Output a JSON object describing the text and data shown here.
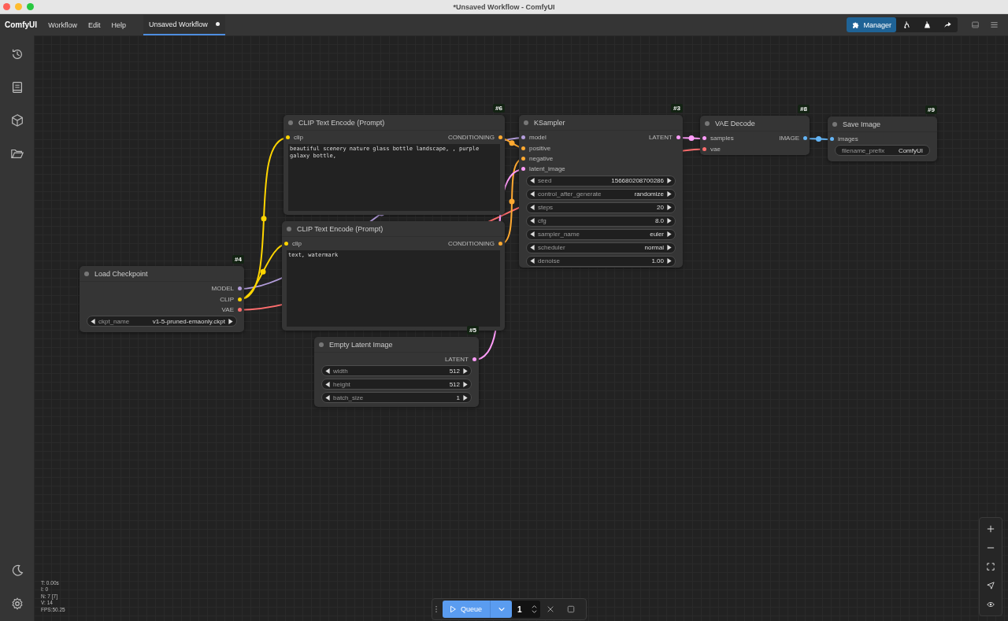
{
  "window": {
    "title": "*Unsaved Workflow - ComfyUI"
  },
  "menubar": {
    "brand": "ComfyUI",
    "menus": [
      {
        "label": "Workflow"
      },
      {
        "label": "Edit"
      },
      {
        "label": "Help"
      }
    ],
    "tabs": [
      {
        "label": "Unsaved Workflow",
        "selected": true,
        "modified": true
      }
    ],
    "manager": "Manager"
  },
  "nodes": [
    {
      "badge": "#4",
      "title": "Load Checkpoint",
      "outputs": [
        {
          "name": "MODEL",
          "color": "#b39ddb"
        },
        {
          "name": "CLIP",
          "color": "#ffd500"
        },
        {
          "name": "VAE",
          "color": "#ff6e6e"
        }
      ],
      "widgets": [
        {
          "kind": "combo",
          "label": "ckpt_name",
          "value": "v1-5-pruned-emaonly.ckpt"
        }
      ]
    },
    {
      "badge": "#6",
      "title": "CLIP Text Encode (Prompt)",
      "inputs": [
        {
          "name": "clip",
          "color": "#ffd500"
        }
      ],
      "outputs": [
        {
          "name": "CONDITIONING",
          "color": "#ffa931"
        }
      ],
      "widgets": [
        {
          "kind": "textarea",
          "value": "beautiful scenery nature glass bottle landscape, , purple galaxy bottle,"
        }
      ]
    },
    {
      "title": "CLIP Text Encode (Prompt)",
      "inputs": [
        {
          "name": "clip",
          "color": "#ffd500"
        }
      ],
      "outputs": [
        {
          "name": "CONDITIONING",
          "color": "#ffa931"
        }
      ],
      "widgets": [
        {
          "kind": "textarea",
          "value": "text, watermark"
        }
      ]
    },
    {
      "badge": "#5",
      "title": "Empty Latent Image",
      "outputs": [
        {
          "name": "LATENT",
          "color": "#ff9cf9"
        }
      ],
      "widgets": [
        {
          "kind": "number",
          "label": "width",
          "value": "512"
        },
        {
          "kind": "number",
          "label": "height",
          "value": "512"
        },
        {
          "kind": "number",
          "label": "batch_size",
          "value": "1"
        }
      ]
    },
    {
      "badge": "#3",
      "title": "KSampler",
      "inputs": [
        {
          "name": "model",
          "color": "#b39ddb"
        },
        {
          "name": "positive",
          "color": "#ffa931"
        },
        {
          "name": "negative",
          "color": "#ffa931"
        },
        {
          "name": "latent_image",
          "color": "#ff9cf9"
        }
      ],
      "outputs": [
        {
          "name": "LATENT",
          "color": "#ff9cf9"
        }
      ],
      "widgets": [
        {
          "kind": "number",
          "label": "seed",
          "value": "156680208700286"
        },
        {
          "kind": "combo",
          "label": "control_after_generate",
          "value": "randomize"
        },
        {
          "kind": "number",
          "label": "steps",
          "value": "20"
        },
        {
          "kind": "number",
          "label": "cfg",
          "value": "8.0"
        },
        {
          "kind": "combo",
          "label": "sampler_name",
          "value": "euler"
        },
        {
          "kind": "combo",
          "label": "scheduler",
          "value": "normal"
        },
        {
          "kind": "number",
          "label": "denoise",
          "value": "1.00"
        }
      ]
    },
    {
      "badge": "#8",
      "title": "VAE Decode",
      "inputs": [
        {
          "name": "samples",
          "color": "#ff9cf9"
        },
        {
          "name": "vae",
          "color": "#ff6e6e"
        }
      ],
      "outputs": [
        {
          "name": "IMAGE",
          "color": "#64b5f6"
        }
      ]
    },
    {
      "badge": "#9",
      "title": "Save Image",
      "inputs": [
        {
          "name": "images",
          "color": "#64b5f6"
        }
      ],
      "widgets": [
        {
          "kind": "string",
          "label": "filename_prefix",
          "value": "ComfyUI"
        }
      ]
    }
  ],
  "stats": [
    "T: 0.00s",
    "I: 0",
    "N: 7 [7]",
    "V: 14",
    "FPS:50.25"
  ],
  "queue": {
    "label": "Queue",
    "count": "1"
  }
}
